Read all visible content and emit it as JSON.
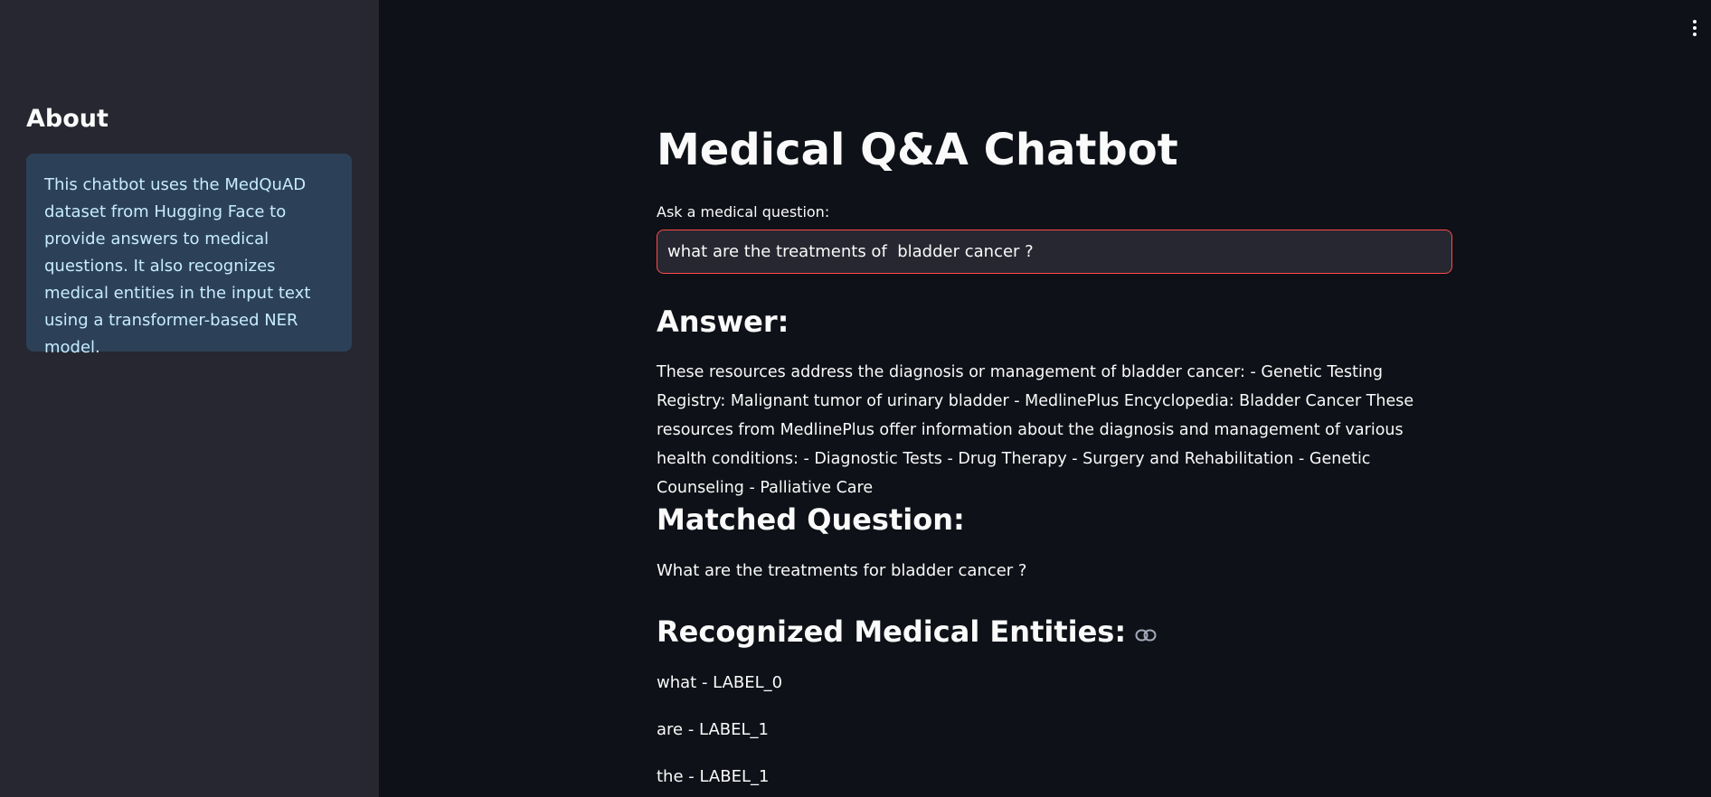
{
  "sidebar": {
    "title": "About",
    "info": "This chatbot uses the MedQuAD dataset from Hugging Face to provide answers to medical questions. It also recognizes medical entities in the input text using a transformer-based NER model."
  },
  "toolbar": {
    "menu_icon": "vertical-ellipsis-icon"
  },
  "main": {
    "title": "Medical Q&A Chatbot",
    "input_label": "Ask a medical question:",
    "input_value": "what are the treatments of  bladder cancer ?",
    "answer_heading": "Answer:",
    "answer_text": "These resources address the diagnosis or management of bladder cancer: - Genetic Testing Registry: Malignant tumor of urinary bladder - MedlinePlus Encyclopedia: Bladder Cancer These resources from MedlinePlus offer information about the diagnosis and management of various health conditions: - Diagnostic Tests - Drug Therapy - Surgery and Rehabilitation - Genetic Counseling - Palliative Care",
    "matched_heading": "Matched Question:",
    "matched_question": "What are the treatments for bladder cancer ?",
    "entities_heading": "Recognized Medical Entities:",
    "entities_link_icon": "link-icon",
    "entities": [
      "what - LABEL_0",
      "are - LABEL_1",
      "the - LABEL_1"
    ]
  },
  "colors": {
    "background": "#0e1117",
    "sidebar": "#262730",
    "info_box": "#2c4157",
    "info_text": "#c7ebff",
    "input_border": "#ff4b4b"
  }
}
